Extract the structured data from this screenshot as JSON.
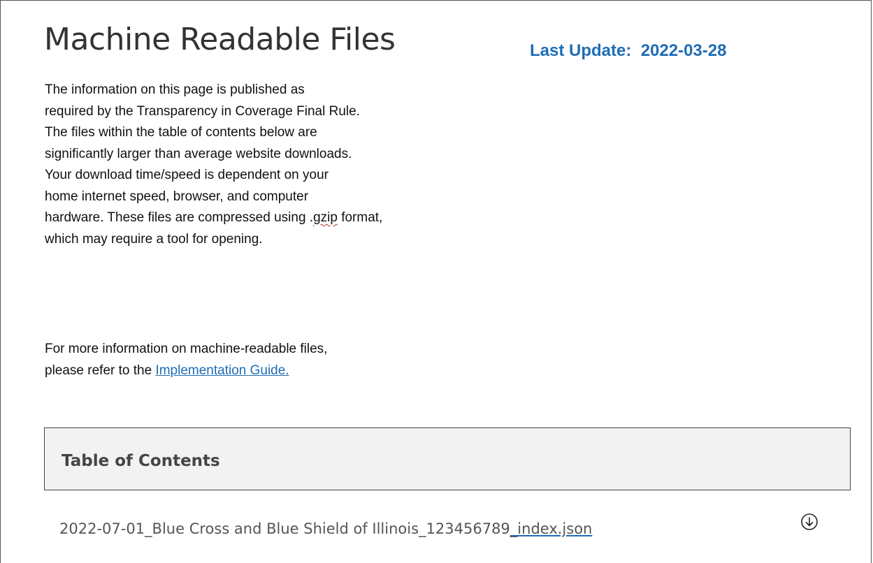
{
  "header": {
    "title": "Machine Readable Files",
    "last_update_label": "Last Update:",
    "last_update_date": "2022-03-28"
  },
  "intro": {
    "text_before": "The information on this page is published as\nrequired by the Transparency in Coverage Final Rule.\nThe files within the table of contents below are\nsignificantly larger than average website downloads.\nYour download time/speed is dependent on your\nhome internet speed, browser, and computer\nhardware.  These files are compressed using .",
    "text_flagged": "gzip",
    "text_after": " format,\nwhich may require a tool for opening."
  },
  "more_info": {
    "line1": "For more information on machine-readable files,",
    "line2_prefix": "please refer to the ",
    "link_text": "Implementation Guide."
  },
  "toc": {
    "title": "Table of Contents",
    "files": [
      {
        "name_prefix": "2022-07-01_Blue Cross and Blue Shield of Illinois_123456789",
        "name_link": "_index.json",
        "icon": "download-circle-icon"
      }
    ]
  },
  "colors": {
    "accent": "#1f6db5",
    "text": "#111111",
    "muted": "#555555",
    "toc_background": "#f2f2f2"
  }
}
